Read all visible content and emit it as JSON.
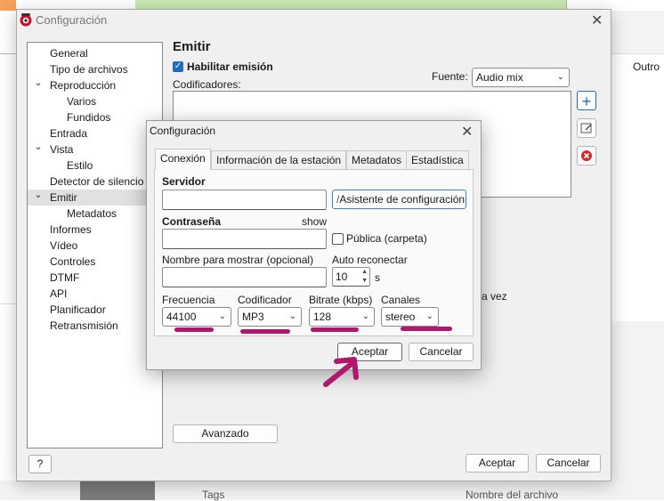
{
  "background": {
    "outro_label": "Outro",
    "tags_label": "Tags",
    "filename_label": "Nombre del archivo",
    "partial_text": "a vez"
  },
  "main_dialog": {
    "title": "Configuración",
    "close_icon": "close-icon",
    "tree": [
      {
        "label": "General",
        "level": 0,
        "expander": ""
      },
      {
        "label": "Tipo de archivos",
        "level": 0,
        "expander": ""
      },
      {
        "label": "Reproducción",
        "level": 0,
        "expander": "v"
      },
      {
        "label": "Varios",
        "level": 1,
        "expander": ""
      },
      {
        "label": "Fundidos",
        "level": 1,
        "expander": ""
      },
      {
        "label": "Entrada",
        "level": 0,
        "expander": ""
      },
      {
        "label": "Vista",
        "level": 0,
        "expander": "v"
      },
      {
        "label": "Estilo",
        "level": 1,
        "expander": ""
      },
      {
        "label": "Detector de silencio",
        "level": 0,
        "expander": ""
      },
      {
        "label": "Emitir",
        "level": 0,
        "expander": "v",
        "selected": true
      },
      {
        "label": "Metadatos",
        "level": 1,
        "expander": ""
      },
      {
        "label": "Informes",
        "level": 0,
        "expander": ""
      },
      {
        "label": "Vídeo",
        "level": 0,
        "expander": ""
      },
      {
        "label": "Controles",
        "level": 0,
        "expander": ""
      },
      {
        "label": "DTMF",
        "level": 0,
        "expander": ""
      },
      {
        "label": "API",
        "level": 0,
        "expander": ""
      },
      {
        "label": "Planificador",
        "level": 0,
        "expander": ""
      },
      {
        "label": "Retransmisión",
        "level": 0,
        "expander": ""
      }
    ],
    "section_title": "Emitir",
    "enable_label": "Habilitar emisión",
    "enable_checked": true,
    "source_label": "Fuente:",
    "source_value": "Audio mix",
    "encoders_label": "Codificadores:",
    "advanced_button": "Avanzado",
    "help_button": "?",
    "ok_button": "Aceptar",
    "cancel_button": "Cancelar"
  },
  "inner_dialog": {
    "title": "Configuración",
    "tabs": [
      "Conexión",
      "Información de la estación",
      "Metadatos",
      "Estadística"
    ],
    "active_tab": 0,
    "server_label": "Servidor",
    "server_value": "",
    "wizard_button": "Asistente de configuración",
    "password_label": "Contraseña",
    "show_label": "show",
    "password_value": "",
    "public_label": "Pública (carpeta)",
    "public_checked": false,
    "display_name_label": "Nombre para mostrar (opcional)",
    "display_name_value": "",
    "auto_reconnect_label": "Auto reconectar",
    "auto_reconnect_value": "10",
    "auto_reconnect_unit": "s",
    "frequency_label": "Frecuencia",
    "frequency_value": "44100",
    "codec_label": "Codificador",
    "codec_value": "MP3",
    "bitrate_label": "Bitrate (kbps)",
    "bitrate_value": "128",
    "channels_label": "Canales",
    "channels_value": "stereo",
    "ok_button": "Aceptar",
    "cancel_button": "Cancelar"
  },
  "colors": {
    "annotation": "#b0186c",
    "accent": "#1b6ec2"
  }
}
